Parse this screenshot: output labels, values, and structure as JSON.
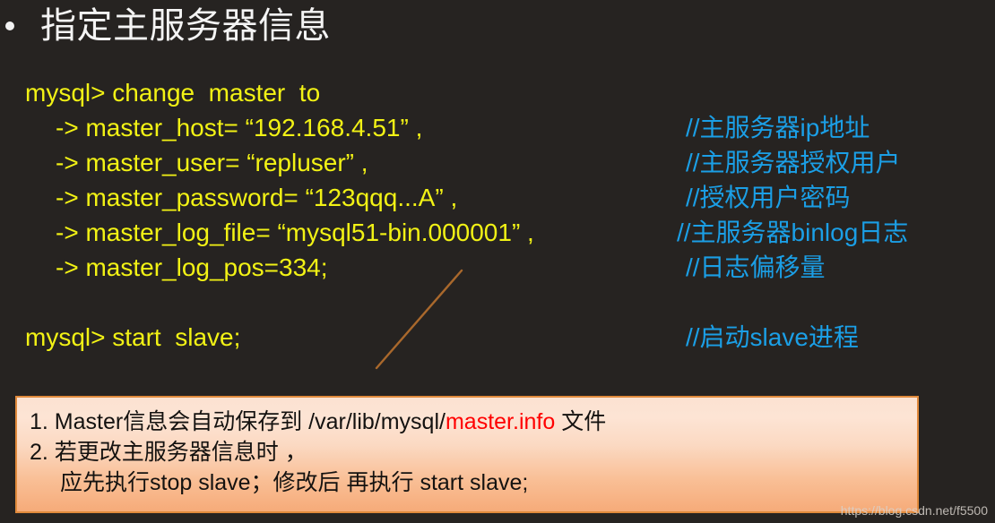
{
  "slide": {
    "background_color": "#262321",
    "title": "指定主服务器信息",
    "bullet": "•"
  },
  "colors": {
    "code_yellow": "#f2f215",
    "comment_blue": "#1b9fe6",
    "title_white": "#f4f4f4",
    "note_border": "#e08a3c",
    "note_bg_top": "#fbe2d2",
    "note_bg_bottom": "#f6ab79",
    "highlight_red": "#ff0000",
    "pointer_line": "#a9682c"
  },
  "code_block": {
    "lines": [
      {
        "command": "mysql> change  master  to",
        "comment": ""
      },
      {
        "command": "-> master_host= “192.168.4.51” ,",
        "comment": "//主服务器ip地址"
      },
      {
        "command": "-> master_user= “repluser” ,",
        "comment": "//主服务器授权用户"
      },
      {
        "command": "-> master_password= “123qqq...A” ,",
        "comment": "//授权用户密码"
      },
      {
        "command": "-> master_log_file= “mysql51-bin.000001” ,",
        "comment": "//主服务器binlog日志"
      },
      {
        "command": "-> master_log_pos=334;",
        "comment": "//日志偏移量"
      },
      {
        "command": "",
        "comment": ""
      },
      {
        "command": "mysql> start  slave;",
        "comment": "//启动slave进程"
      }
    ]
  },
  "note_box": {
    "line1_prefix": "1. Master信息会自动保存到 /var/lib/mysql/",
    "line1_highlight": "master.info",
    "line1_suffix": " 文件",
    "line2": "2. 若更改主服务器信息时 ，",
    "line3": "应先执行stop  slave；修改后 再执行 start  slave;"
  },
  "watermark": {
    "text": "https://blog.csdn.net/f5500"
  }
}
